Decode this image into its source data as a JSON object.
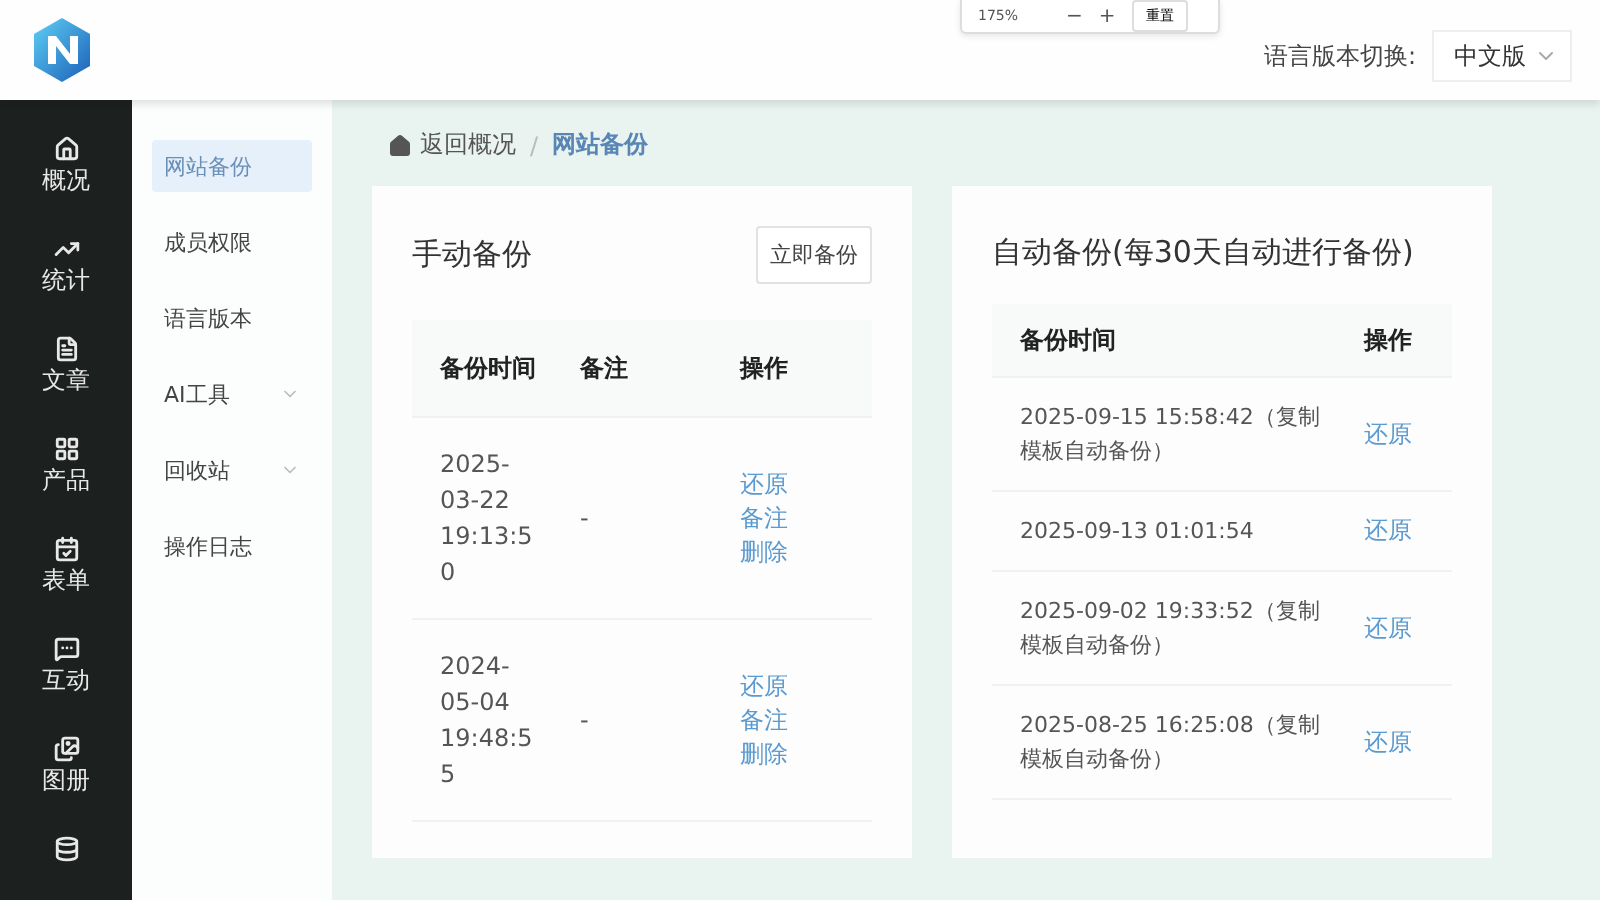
{
  "zoom_popup": {
    "value": "175%",
    "minus": "−",
    "plus": "+",
    "reset": "重置"
  },
  "header": {
    "language_label": "语言版本切换:",
    "language_value": "中文版"
  },
  "nav": [
    {
      "label": "概况",
      "selected": false
    },
    {
      "label": "统计",
      "selected": false
    },
    {
      "label": "文章",
      "selected": false
    },
    {
      "label": "产品",
      "selected": false
    },
    {
      "label": "表单",
      "selected": false
    },
    {
      "label": "互动",
      "selected": false
    },
    {
      "label": "图册",
      "selected": false
    }
  ],
  "submenu": [
    {
      "label": "网站备份",
      "selected": true,
      "expandable": false
    },
    {
      "label": "成员权限",
      "selected": false,
      "expandable": false
    },
    {
      "label": "语言版本",
      "selected": false,
      "expandable": false
    },
    {
      "label": "AI工具",
      "selected": false,
      "expandable": true
    },
    {
      "label": "回收站",
      "selected": false,
      "expandable": true
    },
    {
      "label": "操作日志",
      "selected": false,
      "expandable": false
    }
  ],
  "breadcrumb": {
    "back": "返回概况",
    "separator": "/",
    "current": "网站备份"
  },
  "manual": {
    "title": "手动备份",
    "button": "立即备份",
    "columns": [
      "备份时间",
      "备注",
      "操作"
    ],
    "rows": [
      {
        "time": "2025-03-22 19:13:50",
        "note": "-",
        "actions": [
          "还原",
          "备注",
          "删除"
        ]
      },
      {
        "time": "2024-05-04 19:48:55",
        "note": "-",
        "actions": [
          "还原",
          "备注",
          "删除"
        ]
      }
    ]
  },
  "auto": {
    "title": "自动备份(每30天自动进行备份)",
    "columns": [
      "备份时间",
      "操作"
    ],
    "rows": [
      {
        "time": "2025-09-15 15:58:42（复制模板自动备份）",
        "action": "还原"
      },
      {
        "time": "2025-09-13 01:01:54",
        "action": "还原"
      },
      {
        "time": "2025-09-02 19:33:52（复制模板自动备份）",
        "action": "还原"
      },
      {
        "time": "2025-08-25 16:25:08（复制模板自动备份）",
        "action": "还原"
      }
    ]
  }
}
